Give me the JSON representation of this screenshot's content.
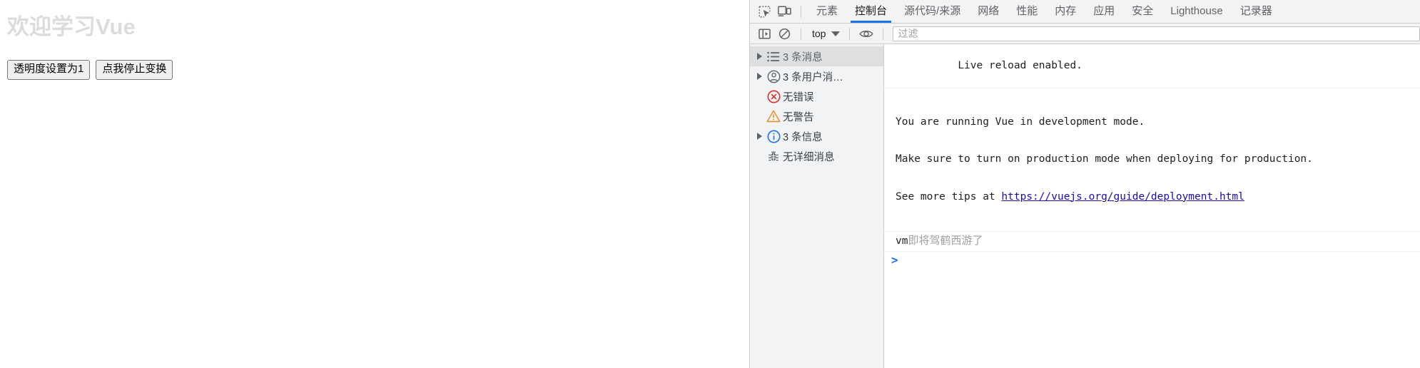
{
  "page": {
    "heading": "欢迎学习Vue",
    "buttons": [
      {
        "label": "透明度设置为1"
      },
      {
        "label": "点我停止变换"
      }
    ]
  },
  "devtools": {
    "toolbar_icons": [
      {
        "name": "inspect-element-icon",
        "title": "检查元素"
      },
      {
        "name": "device-toolbar-icon",
        "title": "切换设备工具栏"
      }
    ],
    "tabs": [
      {
        "label": "元素",
        "selected": false
      },
      {
        "label": "控制台",
        "selected": true
      },
      {
        "label": "源代码/来源",
        "selected": false
      },
      {
        "label": "网络",
        "selected": false
      },
      {
        "label": "性能",
        "selected": false
      },
      {
        "label": "内存",
        "selected": false
      },
      {
        "label": "应用",
        "selected": false
      },
      {
        "label": "安全",
        "selected": false
      },
      {
        "label": "Lighthouse",
        "selected": false
      },
      {
        "label": "记录器",
        "selected": false
      }
    ],
    "console_toolbar": {
      "sidebar_toggle": "console-sidebar-toggle-icon",
      "clear_console": "clear-console-icon",
      "context_value": "top",
      "eye_icon": "live-expression-eye-icon",
      "filter_placeholder": "过滤",
      "filter_value": ""
    },
    "sidebar": {
      "items": [
        {
          "label": "3 条消息",
          "icon": "message-list-icon",
          "expandable": true,
          "selected": true
        },
        {
          "label": "3 条用户消…",
          "icon": "user-message-icon",
          "expandable": true,
          "selected": false
        },
        {
          "label": "无错误",
          "icon": "error-circle-icon",
          "expandable": false,
          "selected": false
        },
        {
          "label": "无警告",
          "icon": "warning-triangle-icon",
          "expandable": false,
          "selected": false
        },
        {
          "label": "3 条信息",
          "icon": "info-circle-icon",
          "expandable": true,
          "selected": false
        },
        {
          "label": "无详细消息",
          "icon": "verbose-bug-icon",
          "expandable": false,
          "selected": false
        }
      ]
    },
    "console_output": {
      "messages": [
        {
          "type": "plain",
          "lines": [
            "Live reload enabled."
          ]
        },
        {
          "type": "multiline",
          "line1": "You are running Vue in development mode.",
          "line2": "Make sure to turn on production mode when deploying for production.",
          "line3_prefix": "See more tips at ",
          "link_text": "https://vuejs.org/guide/deployment.html"
        },
        {
          "type": "cn",
          "prefix": "vm",
          "text": "即将驾鹤西游了"
        }
      ],
      "prompt": ">"
    },
    "colors": {
      "accent": "#1a73e8",
      "error": "#d93025",
      "warning": "#e8912d",
      "info": "#1a73e8",
      "link": "#1a0dab",
      "toolbar_bg": "#f3f3f3",
      "sidebar_bg": "#f1f3f4"
    }
  }
}
